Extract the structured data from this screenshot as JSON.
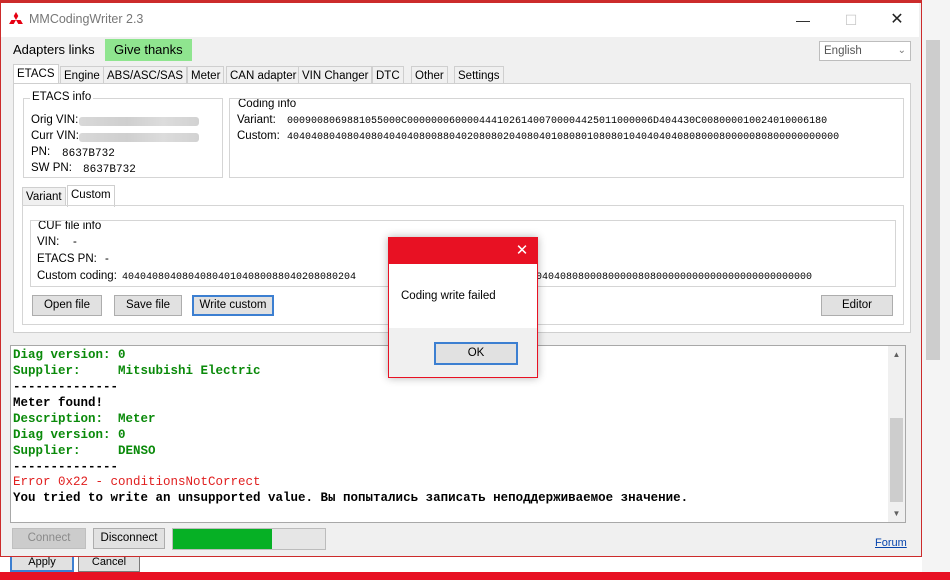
{
  "back_window": {
    "apply_label": "Apply",
    "cancel_label": "Cancel"
  },
  "app": {
    "title": "MMCodingWriter 2.3",
    "icon": "mitsubishi-logo-icon"
  },
  "menu": {
    "adapters_links": "Adapters links",
    "give_thanks": "Give thanks",
    "language": "English",
    "forum": "Forum"
  },
  "tabs": [
    "ETACS",
    "Engine",
    "ABS/ASC/SAS",
    "Meter",
    "CAN adapter",
    "VIN Changer",
    "DTC",
    "Other",
    "Settings"
  ],
  "etacs_info": {
    "title": "ETACS info",
    "orig_vin_label": "Orig VIN:",
    "curr_vin_label": "Curr VIN:",
    "pn_label": "PN:",
    "pn_value": "8637B732",
    "swpn_label": "SW PN:",
    "swpn_value": "8637B732"
  },
  "coding_info": {
    "title": "Coding info",
    "variant_label": "Variant:",
    "variant_value": "0009008069881055000C00000006000044410261400700004425011000006D404430C008000010024010006180",
    "custom_label": "Custom:",
    "custom_value": "40404080408040804040408008804020808020408040108080108080104040404080800080000080800000000000"
  },
  "subtabs": [
    "Variant",
    "Custom"
  ],
  "cuf_info": {
    "title": "CUF file info",
    "vin_label": "VIN:",
    "vin_value": "-",
    "etacs_pn_label": "ETACS PN:",
    "etacs_pn_value": "-",
    "custom_coding_label": "Custom coding:",
    "custom_coding_left": "404040804080408040104080088040208080204",
    "custom_coding_right": "0404080800080000080800000000000000000000000000"
  },
  "buttons": {
    "open_file": "Open file",
    "save_file": "Save file",
    "write_custom": "Write custom",
    "editor": "Editor",
    "connect": "Connect",
    "disconnect": "Disconnect"
  },
  "progress": {
    "percent": 65,
    "color": "#06b025"
  },
  "log": [
    {
      "text": "Diag version: 0",
      "color": "#0a8a0a"
    },
    {
      "text": "Supplier:     Mitsubishi Electric",
      "color": "#0a8a0a"
    },
    {
      "text": "--------------",
      "color": "#000000"
    },
    {
      "text": "Meter found!",
      "color": "#000000"
    },
    {
      "text": "Description:  Meter",
      "color": "#0a8a0a"
    },
    {
      "text": "Diag version: 0",
      "color": "#0a8a0a"
    },
    {
      "text": "Supplier:     DENSO",
      "color": "#0a8a0a"
    },
    {
      "text": "--------------",
      "color": "#000000"
    },
    {
      "text": "Error 0x22 - conditionsNotCorrect",
      "color": "#e02020"
    },
    {
      "text": "You tried to write an unsupported value. Вы попытались записать неподдерживаемое значение.",
      "color": "#000000"
    }
  ],
  "dialog": {
    "message": "Coding write failed",
    "ok_label": "OK"
  },
  "colors": {
    "accent": "#e81123",
    "thanks_bg": "#8fe58f"
  }
}
